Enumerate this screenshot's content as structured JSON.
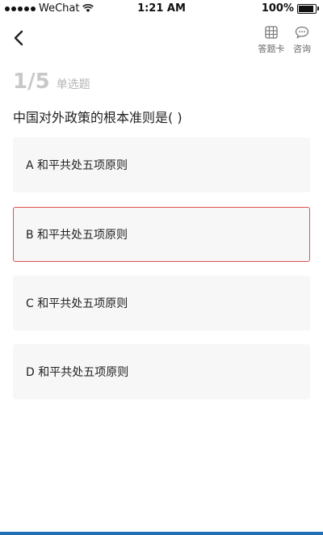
{
  "status_bar": {
    "carrier": "WeChat",
    "time": "1:21 AM",
    "battery": "100%",
    "battery_level": 1.0
  },
  "nav": {
    "answer_card_label": "答题卡",
    "consult_label": "咨询"
  },
  "progress": {
    "current_total": "1/5",
    "type": "单选题"
  },
  "question": {
    "text": "中国对外政策的根本准则是( )"
  },
  "options": [
    {
      "text": "A 和平共处五项原则",
      "selected": false
    },
    {
      "text": "B 和平共处五项原则",
      "selected": true
    },
    {
      "text": "C 和平共处五项原则",
      "selected": false
    },
    {
      "text": "D 和平共处五项原则",
      "selected": false
    }
  ],
  "colors": {
    "selected_border": "#e35050",
    "option_bg": "#f7f7f7",
    "bottom_strip": "#1f6fb5"
  }
}
